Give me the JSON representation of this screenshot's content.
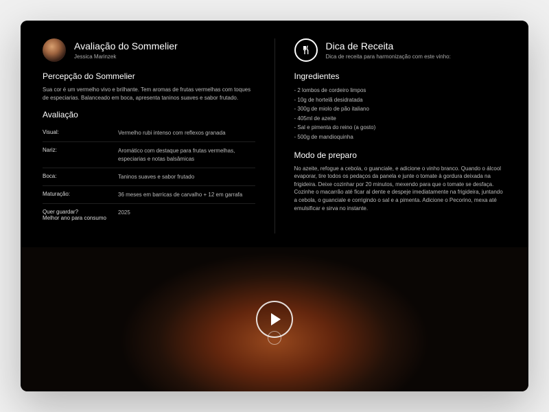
{
  "sommelier": {
    "title": "Avaliação do Sommelier",
    "author": "Jessica Marinzek",
    "perception_title": "Percepção do Sommelier",
    "perception_body": "Sua cor é um vermelho vivo e brilhante. Tem aromas de frutas vermelhas com toques de especiarias. Balanceado em boca, apresenta taninos suaves e sabor frutado.",
    "eval_title": "Avaliação",
    "rows": [
      {
        "label": "Visual:",
        "value": "Vermelho rubi intenso com reflexos granada"
      },
      {
        "label": "Nariz:",
        "value": "Aromático com destaque para frutas vermelhas, especiarias e notas balsâmicas"
      },
      {
        "label": "Boca:",
        "value": "Taninos suaves e sabor frutado"
      },
      {
        "label": "Maturação:",
        "value": "36 meses em barricas de carvalho + 12 em garrafa"
      },
      {
        "label": "Quer guardar?\nMelhor ano para consumo",
        "value": "2025"
      }
    ]
  },
  "recipe": {
    "title": "Dica de Receita",
    "subtitle": "Dica de receita para harmonização com este vinho:",
    "ingredients_title": "Ingredientes",
    "ingredients": [
      "- 2 lombos de cordeiro limpos",
      "- 10g de hortelã desidratada",
      "- 300g de miolo de pão italiano",
      "- 405ml de azeite",
      "- Sal e pimenta do reino (a gosto)",
      "- 500g de mandioquinha"
    ],
    "method_title": "Modo de preparo",
    "method_body": "No azeite, refogue a cebola, o guanciale, e adicione o vinho branco. Quando o álcool evaporar, tire todos os pedaços da panela e junte o tomate à gordura deixada na frigideira. Deixe cozinhar por 20 minutos, mexendo para que o tomate se desfaça. Cozinhe o macarrão até ficar al dente e despeje imediatamente na frigideira, juntando a cebola, o guanciale e corrigindo o sal e a pimenta. Adicione o Pecorino, mexa até emulsificar e sirva no instante."
  }
}
